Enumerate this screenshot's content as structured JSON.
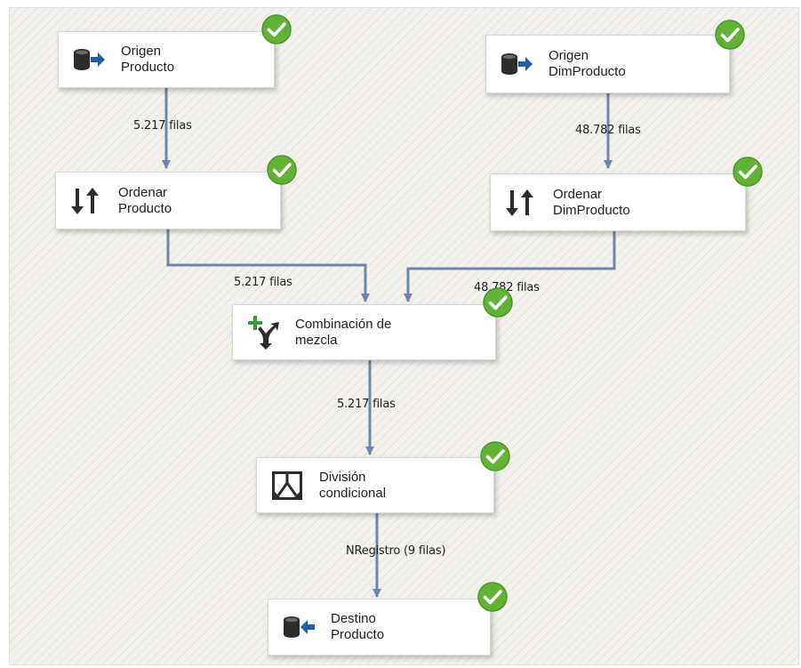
{
  "colors": {
    "connector": "#6d86a8",
    "success": "#62b236",
    "canvas_bg": "#f3f1ec",
    "icon_dark": "#2c2c2c",
    "icon_blue": "#1f5fa6",
    "icon_green": "#3a9a3a"
  },
  "nodes": {
    "origen_producto": {
      "line1": "Origen",
      "line2": "Producto",
      "icon": "source-icon",
      "status": "success"
    },
    "origen_dimproducto": {
      "line1": "Origen",
      "line2": "DimProducto",
      "icon": "source-icon",
      "status": "success"
    },
    "ordenar_producto": {
      "line1": "Ordenar",
      "line2": "Producto",
      "icon": "sort-icon",
      "status": "success"
    },
    "ordenar_dimproducto": {
      "line1": "Ordenar",
      "line2": "DimProducto",
      "icon": "sort-icon",
      "status": "success"
    },
    "combinacion": {
      "line1": "Combinación de",
      "line2": "mezcla",
      "icon": "merge-join-icon",
      "status": "success"
    },
    "division": {
      "line1": "División",
      "line2": "condicional",
      "icon": "conditional-split-icon",
      "status": "success"
    },
    "destino_producto": {
      "line1": "Destino",
      "line2": "Producto",
      "icon": "destination-icon",
      "status": "success"
    }
  },
  "flows": {
    "f1": "5.217 filas",
    "f2": "48.782 filas",
    "f3": "5.217 filas",
    "f4": "48.782 filas",
    "f5": "5.217 filas",
    "f6": "NRegistro (9 filas)"
  }
}
